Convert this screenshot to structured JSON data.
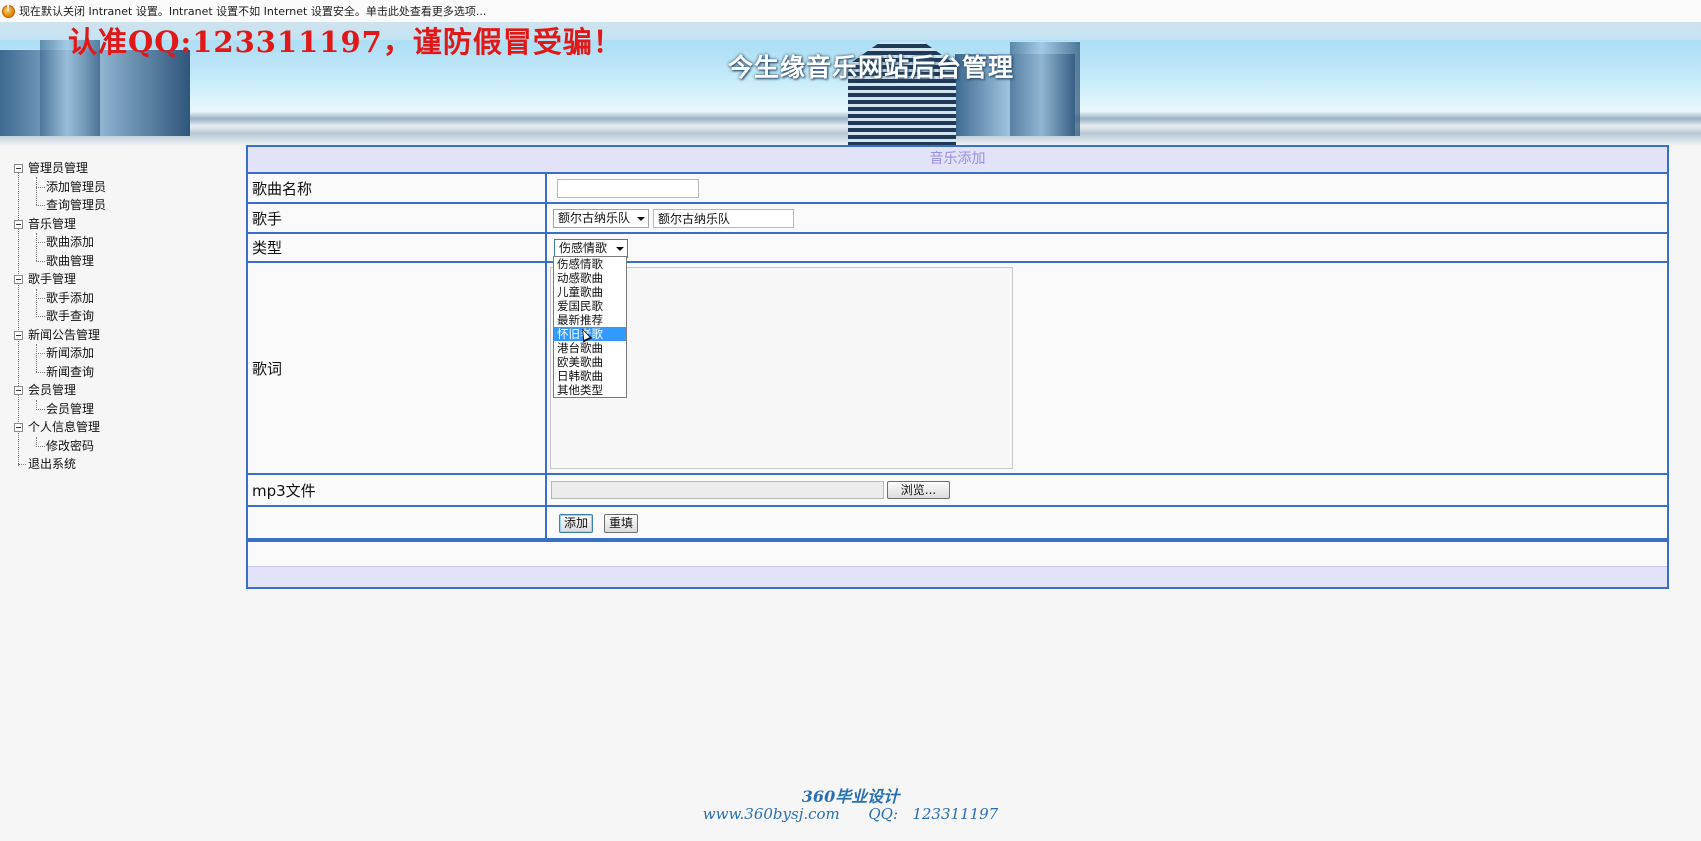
{
  "infobar": {
    "text": "现在默认关闭 Intranet 设置。Intranet 设置不如 Internet 设置安全。单击此处查看更多选项..."
  },
  "header": {
    "watermark": "认准QQ:123311197，谨防假冒受骗！",
    "title": "今生缘音乐网站后台管理"
  },
  "sidebar": {
    "groups": [
      {
        "label": "管理员管理",
        "items": [
          "添加管理员",
          "查询管理员"
        ]
      },
      {
        "label": "音乐管理",
        "items": [
          "歌曲添加",
          "歌曲管理"
        ]
      },
      {
        "label": "歌手管理",
        "items": [
          "歌手添加",
          "歌手查询"
        ]
      },
      {
        "label": "新闻公告管理",
        "items": [
          "新闻添加",
          "新闻查询"
        ]
      },
      {
        "label": "会员管理",
        "items": [
          "会员管理"
        ]
      },
      {
        "label": "个人信息管理",
        "items": [
          "修改密码"
        ]
      }
    ],
    "logout": "退出系统"
  },
  "form": {
    "caption": "音乐添加",
    "song_name": {
      "label": "歌曲名称",
      "value": ""
    },
    "singer": {
      "label": "歌手",
      "selected": "额尔古纳乐队",
      "text_value": "额尔古纳乐队"
    },
    "type": {
      "label": "类型",
      "selected": "伤感情歌",
      "options": [
        "伤感情歌",
        "动感歌曲",
        "儿童歌曲",
        "爱国民歌",
        "最新推荐",
        "怀旧老歌",
        "港台歌曲",
        "欧美歌曲",
        "日韩歌曲",
        "其他类型"
      ],
      "highlighted_index": 5
    },
    "lyrics": {
      "label": "歌词",
      "value": ""
    },
    "mp3": {
      "label": "mp3文件",
      "value": "",
      "browse": "浏览..."
    },
    "buttons": {
      "add": "添加",
      "reset": "重填"
    }
  },
  "footer": {
    "line1": "360毕业设计",
    "line2": "www.360bysj.com      QQ:   123311197"
  }
}
